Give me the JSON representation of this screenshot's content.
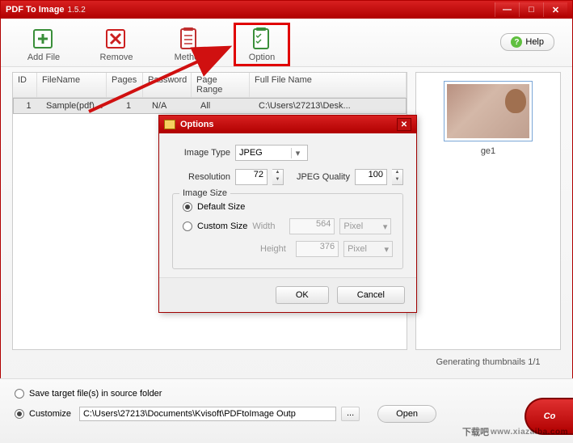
{
  "window": {
    "title": "PDF To Image",
    "version": "1.5.2"
  },
  "toolbar": {
    "addFile": "Add File",
    "remove": "Remove",
    "method": "Method",
    "option": "Option",
    "help": "Help"
  },
  "table": {
    "headers": {
      "id": "ID",
      "fileName": "FileName",
      "pages": "Pages",
      "password": "Password",
      "pageRange": "Page Range",
      "fullFileName": "Full File Name"
    },
    "rows": [
      {
        "id": "1",
        "fileName": "Sample(pdf).pdf",
        "pages": "1",
        "password": "N/A",
        "pageRange": "All",
        "fullFileName": "C:\\Users\\27213\\Desk..."
      }
    ]
  },
  "preview": {
    "thumbLabel": "ge1",
    "status": "Generating thumbnails 1/1"
  },
  "options": {
    "dialogTitle": "Options",
    "imageTypeLabel": "Image Type",
    "imageTypeValue": "JPEG",
    "resolutionLabel": "Resolution",
    "resolutionValue": "72",
    "jpegQualityLabel": "JPEG Quality",
    "jpegQualityValue": "100",
    "imageSizeGroup": "Image Size",
    "defaultSize": "Default Size",
    "customSize": "Custom Size",
    "widthLabel": "Width",
    "widthValue": "564",
    "heightLabel": "Height",
    "heightValue": "376",
    "unit": "Pixel",
    "ok": "OK",
    "cancel": "Cancel"
  },
  "output": {
    "saveInSource": "Save target file(s) in source folder",
    "customize": "Customize",
    "path": "C:\\Users\\27213\\Documents\\Kvisoft\\PDFtoImage Outp",
    "browse": "...",
    "open": "Open",
    "convert": "Co"
  },
  "watermark": {
    "text": "下载吧",
    "url": "www.xiazaiba.com"
  }
}
